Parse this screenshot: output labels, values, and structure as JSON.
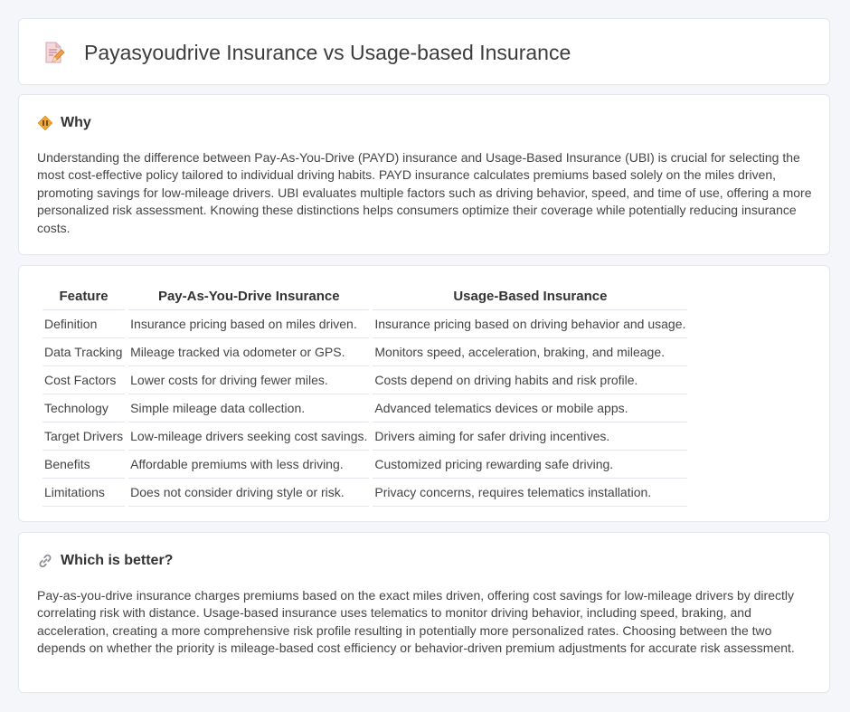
{
  "page": {
    "title": "Payasyoudrive Insurance vs Usage-based Insurance"
  },
  "why": {
    "heading": "Why",
    "text": "Understanding the difference between Pay-As-You-Drive (PAYD) insurance and Usage-Based Insurance (UBI) is crucial for selecting the most cost-effective policy tailored to individual driving habits. PAYD insurance calculates premiums based solely on the miles driven, promoting savings for low-mileage drivers. UBI evaluates multiple factors such as driving behavior, speed, and time of use, offering a more personalized risk assessment. Knowing these distinctions helps consumers optimize their coverage while potentially reducing insurance costs."
  },
  "table": {
    "headers": [
      "Feature",
      "Pay-As-You-Drive Insurance",
      "Usage-Based Insurance"
    ],
    "rows": [
      [
        "Definition",
        "Insurance pricing based on miles driven.",
        "Insurance pricing based on driving behavior and usage."
      ],
      [
        "Data Tracking",
        "Mileage tracked via odometer or GPS.",
        "Monitors speed, acceleration, braking, and mileage."
      ],
      [
        "Cost Factors",
        "Lower costs for driving fewer miles.",
        "Costs depend on driving habits and risk profile."
      ],
      [
        "Technology",
        "Simple mileage data collection.",
        "Advanced telematics devices or mobile apps."
      ],
      [
        "Target Drivers",
        "Low-mileage drivers seeking cost savings.",
        "Drivers aiming for safer driving incentives."
      ],
      [
        "Benefits",
        "Affordable premiums with less driving.",
        "Customized pricing rewarding safe driving."
      ],
      [
        "Limitations",
        "Does not consider driving style or risk.",
        "Privacy concerns, requires telematics installation."
      ]
    ]
  },
  "better": {
    "heading": "Which is better?",
    "text": "Pay-as-you-drive insurance charges premiums based on the exact miles driven, offering cost savings for low-mileage drivers by directly correlating risk with distance. Usage-based insurance uses telematics to monitor driving behavior, including speed, braking, and acceleration, creating a more comprehensive risk profile resulting in potentially more personalized rates. Choosing between the two depends on whether the priority is mileage-based cost efficiency or behavior-driven premium adjustments for accurate risk assessment."
  },
  "icons": {
    "title": "document-pencil-icon",
    "why": "warning-diamond-icon",
    "better": "link-icon"
  }
}
